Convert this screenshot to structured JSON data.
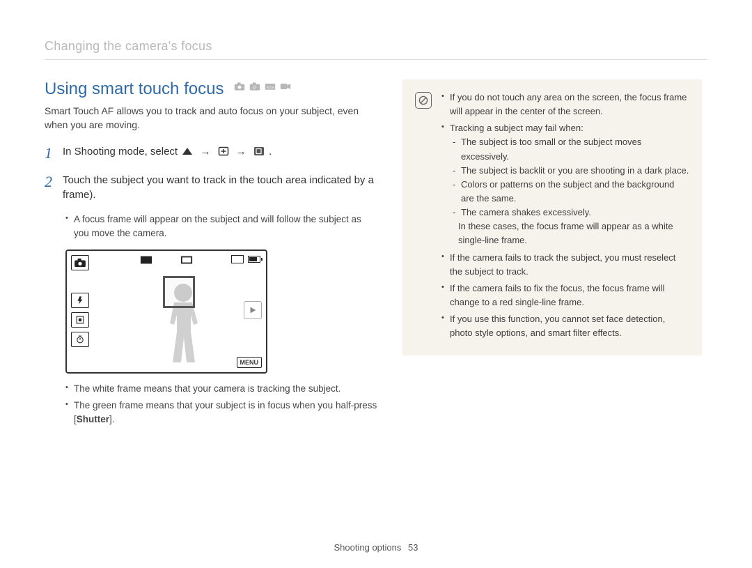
{
  "breadcrumb": "Changing the camera's focus",
  "heading": "Using smart touch focus",
  "intro": "Smart Touch AF allows you to track and auto focus on your subject, even when you are moving.",
  "steps": {
    "s1": {
      "num": "1",
      "prefix": "In Shooting mode, select ",
      "arrow": "→",
      "suffix": "."
    },
    "s2": {
      "num": "2",
      "text": "Touch the subject you want to track in the touch area indicated by a frame).",
      "sub": [
        "A focus frame will appear on the subject and will follow the subject as you move the camera."
      ]
    },
    "after_bullets": {
      "b1": "The white frame means that your camera is tracking the subject.",
      "b2_pre": "The green frame means that your subject is in focus when you half-press [",
      "b2_bold": "Shutter",
      "b2_post": "]."
    }
  },
  "lcd": {
    "menu_label": "MENU"
  },
  "notes": {
    "n1": "If you do not touch any area on the screen, the focus frame will appear in the center of the screen.",
    "n2": "Tracking a subject may fail when:",
    "n2_sub": [
      "The subject is too small or the subject moves excessively.",
      "The subject is backlit or you are shooting in a dark place.",
      "Colors or patterns on the subject and the background are the same.",
      "The camera shakes excessively."
    ],
    "n2_follow": "In these cases, the focus frame will appear as a white single-line frame.",
    "n3": "If the camera fails to track the subject, you must reselect the subject to track.",
    "n4": "If the camera fails to fix the focus, the focus frame will change to a red single-line frame.",
    "n5": "If you use this function, you cannot set face detection, photo style options, and smart filter effects."
  },
  "footer": {
    "section": "Shooting options",
    "page": "53"
  }
}
